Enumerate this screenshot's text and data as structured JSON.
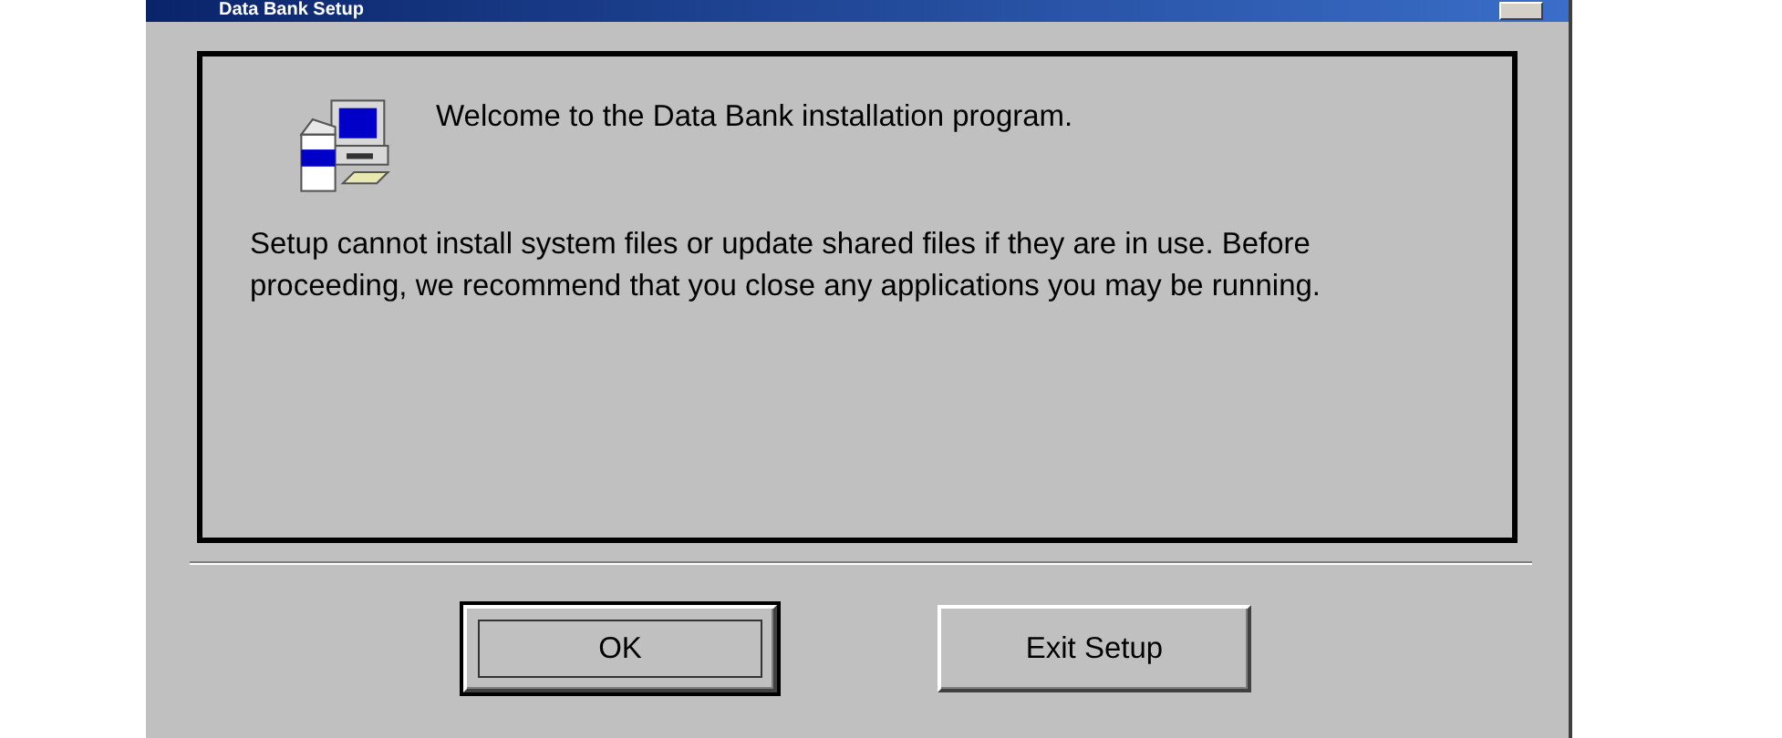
{
  "window": {
    "title": "Data Bank Setup"
  },
  "welcome": "Welcome to the Data Bank installation program.",
  "message": "Setup cannot install system files or update shared files if they are in use. Before proceeding, we recommend that you close any applications you may be running.",
  "buttons": [
    {
      "label": "OK",
      "default": true
    },
    {
      "label": "Exit Setup",
      "default": false
    }
  ]
}
